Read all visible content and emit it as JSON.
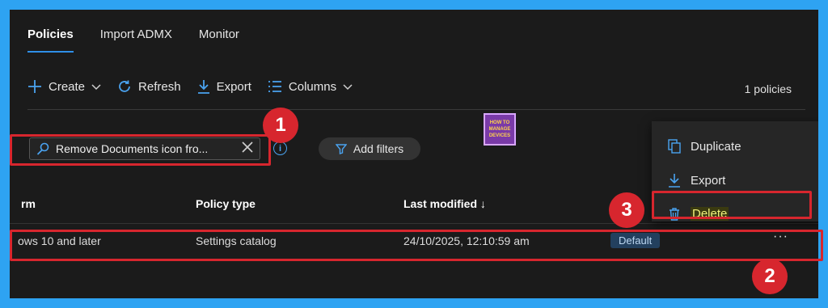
{
  "tabs": [
    {
      "label": "Policies",
      "active": true
    },
    {
      "label": "Import ADMX",
      "active": false
    },
    {
      "label": "Monitor",
      "active": false
    }
  ],
  "toolbar": {
    "create": "Create",
    "refresh": "Refresh",
    "export": "Export",
    "columns": "Columns",
    "count": "1 policies"
  },
  "search": {
    "value": "Remove Documents icon fro..."
  },
  "filters": {
    "label": "Add filters"
  },
  "logo": {
    "line1": "HOW TO",
    "line2": "MANAGE",
    "line3": "DEVICES"
  },
  "table": {
    "headers": [
      "rm",
      "Policy type",
      "Last modified ↓"
    ],
    "rows": [
      {
        "platform": "ows 10 and later",
        "policy_type": "Settings catalog",
        "last_modified": "24/10/2025, 12:10:59 am",
        "badge": "Default"
      }
    ]
  },
  "menu": {
    "duplicate": "Duplicate",
    "export": "Export",
    "delete": "Delete"
  },
  "annotations": {
    "n1": "1",
    "n2": "2",
    "n3": "3"
  },
  "colors": {
    "accent": "#2f8fe8",
    "highlight": "#d7262e",
    "frame": "#2ea3f2"
  }
}
